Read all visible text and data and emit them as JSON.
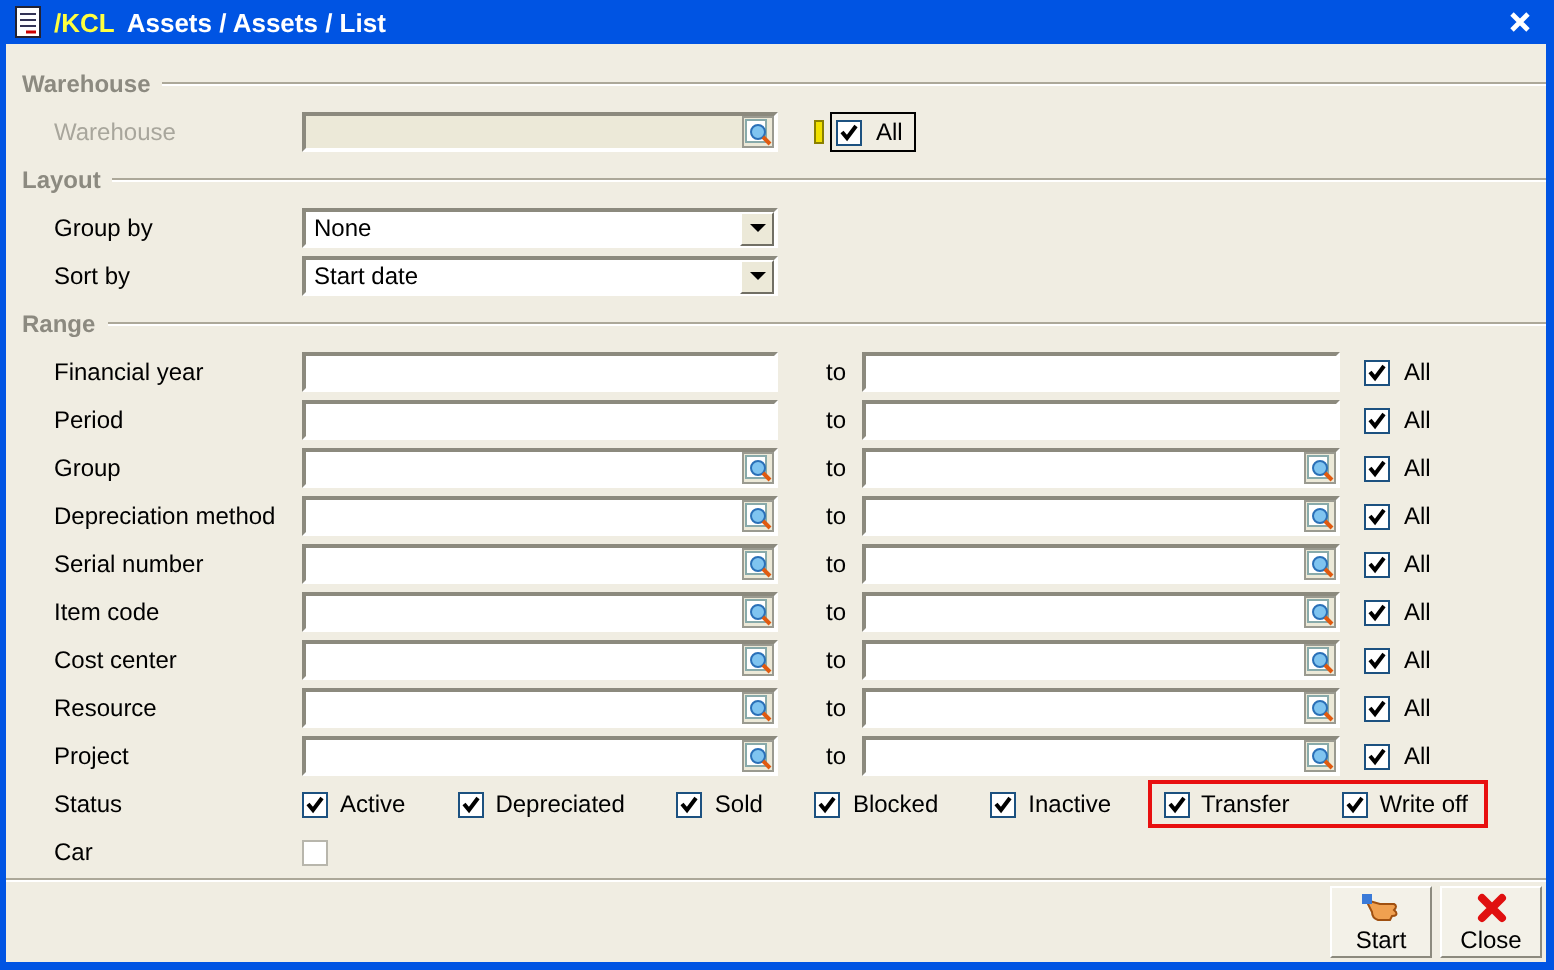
{
  "window": {
    "prefix": "/KCL",
    "title": "Assets / Assets / List"
  },
  "sections": [
    {
      "title": "Warehouse",
      "rows": [
        {
          "kind": "lookup",
          "label": "Warehouse",
          "disabled": true,
          "all": {
            "label": "All",
            "checked": true,
            "focused": true
          }
        }
      ]
    },
    {
      "title": "Layout",
      "rows": [
        {
          "kind": "dropdown",
          "label": "Group by",
          "value": "None"
        },
        {
          "kind": "dropdown",
          "label": "Sort by",
          "value": "Start date"
        }
      ]
    },
    {
      "title": "Range",
      "rows": [
        {
          "kind": "range",
          "label": "Financial year",
          "lookup": false,
          "to": "to",
          "all": {
            "label": "All",
            "checked": true
          }
        },
        {
          "kind": "range",
          "label": "Period",
          "lookup": false,
          "to": "to",
          "all": {
            "label": "All",
            "checked": true
          }
        },
        {
          "kind": "range",
          "label": "Group",
          "lookup": true,
          "to": "to",
          "all": {
            "label": "All",
            "checked": true
          }
        },
        {
          "kind": "range",
          "label": "Depreciation method",
          "lookup": true,
          "to": "to",
          "all": {
            "label": "All",
            "checked": true
          }
        },
        {
          "kind": "range",
          "label": "Serial number",
          "lookup": true,
          "to": "to",
          "all": {
            "label": "All",
            "checked": true
          }
        },
        {
          "kind": "range",
          "label": "Item code",
          "lookup": true,
          "to": "to",
          "all": {
            "label": "All",
            "checked": true
          }
        },
        {
          "kind": "range",
          "label": "Cost center",
          "lookup": true,
          "to": "to",
          "all": {
            "label": "All",
            "checked": true
          }
        },
        {
          "kind": "range",
          "label": "Resource",
          "lookup": true,
          "to": "to",
          "all": {
            "label": "All",
            "checked": true
          }
        },
        {
          "kind": "range",
          "label": "Project",
          "lookup": true,
          "to": "to",
          "all": {
            "label": "All",
            "checked": true
          }
        },
        {
          "kind": "checks",
          "label": "Status",
          "options": [
            {
              "label": "Active",
              "checked": true,
              "highlighted": false
            },
            {
              "label": "Depreciated",
              "checked": true,
              "highlighted": false
            },
            {
              "label": "Sold",
              "checked": true,
              "highlighted": false
            },
            {
              "label": "Blocked",
              "checked": true,
              "highlighted": false
            },
            {
              "label": "Inactive",
              "checked": true,
              "highlighted": false
            },
            {
              "label": "Transfer",
              "checked": true,
              "highlighted": true
            },
            {
              "label": "Write off",
              "checked": true,
              "highlighted": true
            }
          ]
        },
        {
          "kind": "checkbox",
          "label": "Car",
          "checked": false
        }
      ]
    }
  ],
  "buttons": [
    {
      "kind": "start",
      "label": "Start"
    },
    {
      "kind": "close",
      "label": "Close"
    }
  ]
}
